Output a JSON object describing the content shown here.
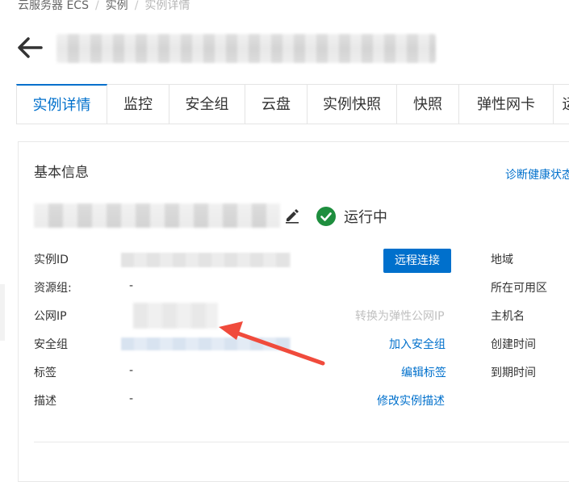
{
  "breadcrumb": [
    "云服务器 ECS",
    "实例",
    "实例详情"
  ],
  "tabs": [
    "实例详情",
    "监控",
    "安全组",
    "云盘",
    "实例快照",
    "快照",
    "弹性网卡",
    "运"
  ],
  "active_tab": "实例详情",
  "section": {
    "title": "基本信息",
    "diagnose_link": "诊断健康状态"
  },
  "status": {
    "label": "运行中"
  },
  "fields_left": {
    "instance_id": "实例ID",
    "resource_group": "资源组:",
    "resource_group_value": "-",
    "public_ip": "公网IP",
    "security_group": "安全组",
    "tags": "标签",
    "tags_value": "-",
    "description": "描述",
    "description_value": "-"
  },
  "actions": {
    "remote_connect": "远程连接",
    "convert_eip": "转换为弹性公网IP",
    "join_sg": "加入安全组",
    "edit_tags": "编辑标签",
    "edit_desc": "修改实例描述"
  },
  "fields_right": {
    "region": "地域",
    "zone": "所在可用区",
    "hostname": "主机名",
    "created": "创建时间",
    "expires": "到期时间"
  },
  "colors": {
    "primary": "#0070cc",
    "success": "#1e8e3e",
    "annotation": "#f04b3c"
  },
  "icons": {
    "back": "arrow-left-icon",
    "edit": "pencil-icon",
    "status": "check-circle-icon"
  }
}
